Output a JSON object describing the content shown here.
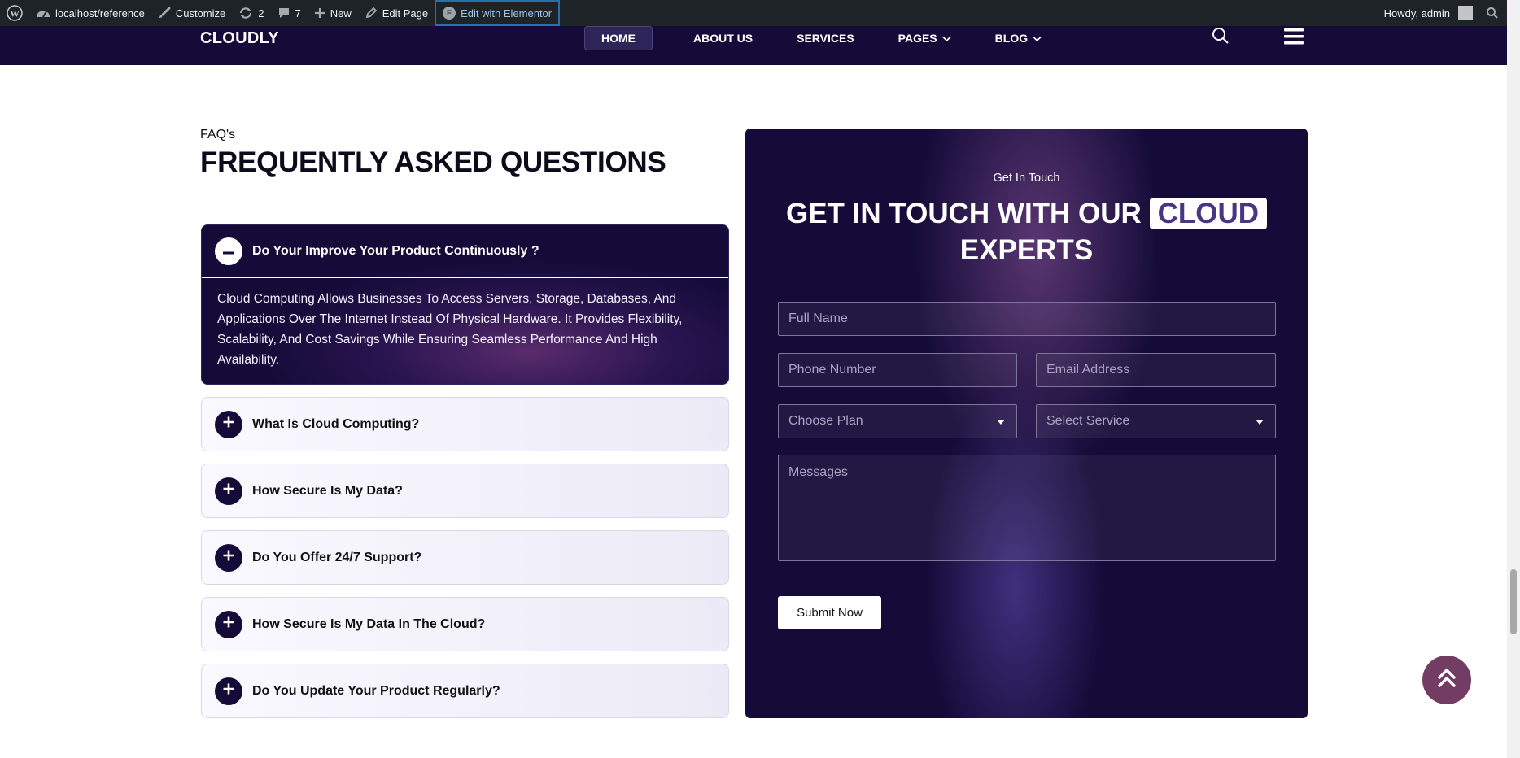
{
  "admin_bar": {
    "site": "localhost/reference",
    "customize": "Customize",
    "updates_count": "2",
    "comments_count": "7",
    "new": "New",
    "edit_page": "Edit Page",
    "edit_elementor": "Edit with Elementor",
    "greeting": "Howdy, admin"
  },
  "header": {
    "logo": "CLOUDLY",
    "nav": [
      "HOME",
      "ABOUT US",
      "SERVICES",
      "PAGES",
      "BLOG"
    ]
  },
  "faq": {
    "kicker": "FAQ's",
    "title": "FREQUENTLY ASKED QUESTIONS",
    "open_item": {
      "question": "Do Your Improve Your Product Continuously ?",
      "answer": "Cloud Computing Allows Businesses To Access Servers, Storage, Databases, And Applications Over The Internet Instead Of Physical Hardware. It Provides Flexibility, Scalability, And Cost Savings While Ensuring Seamless Performance And High Availability."
    },
    "items": [
      "What Is Cloud Computing?",
      "How Secure Is My Data?",
      "Do You Offer 24/7 Support?",
      "How Secure Is My Data In The Cloud?",
      "Do You Update Your Product Regularly?"
    ]
  },
  "contact": {
    "kicker": "Get In Touch",
    "title_part1": "GET IN TOUCH WITH OUR",
    "title_highlight": "CLOUD",
    "title_part2": "EXPERTS",
    "full_name_placeholder": "Full Name",
    "phone_placeholder": "Phone Number",
    "email_placeholder": "Email Address",
    "plan_select": "Choose Plan",
    "service_select": "Select Service",
    "message_placeholder": "Messages",
    "submit": "Submit Now"
  },
  "colors": {
    "brand_dark": "#140b38",
    "accent_purple": "#4a3584",
    "back_to_top": "#733d63"
  }
}
